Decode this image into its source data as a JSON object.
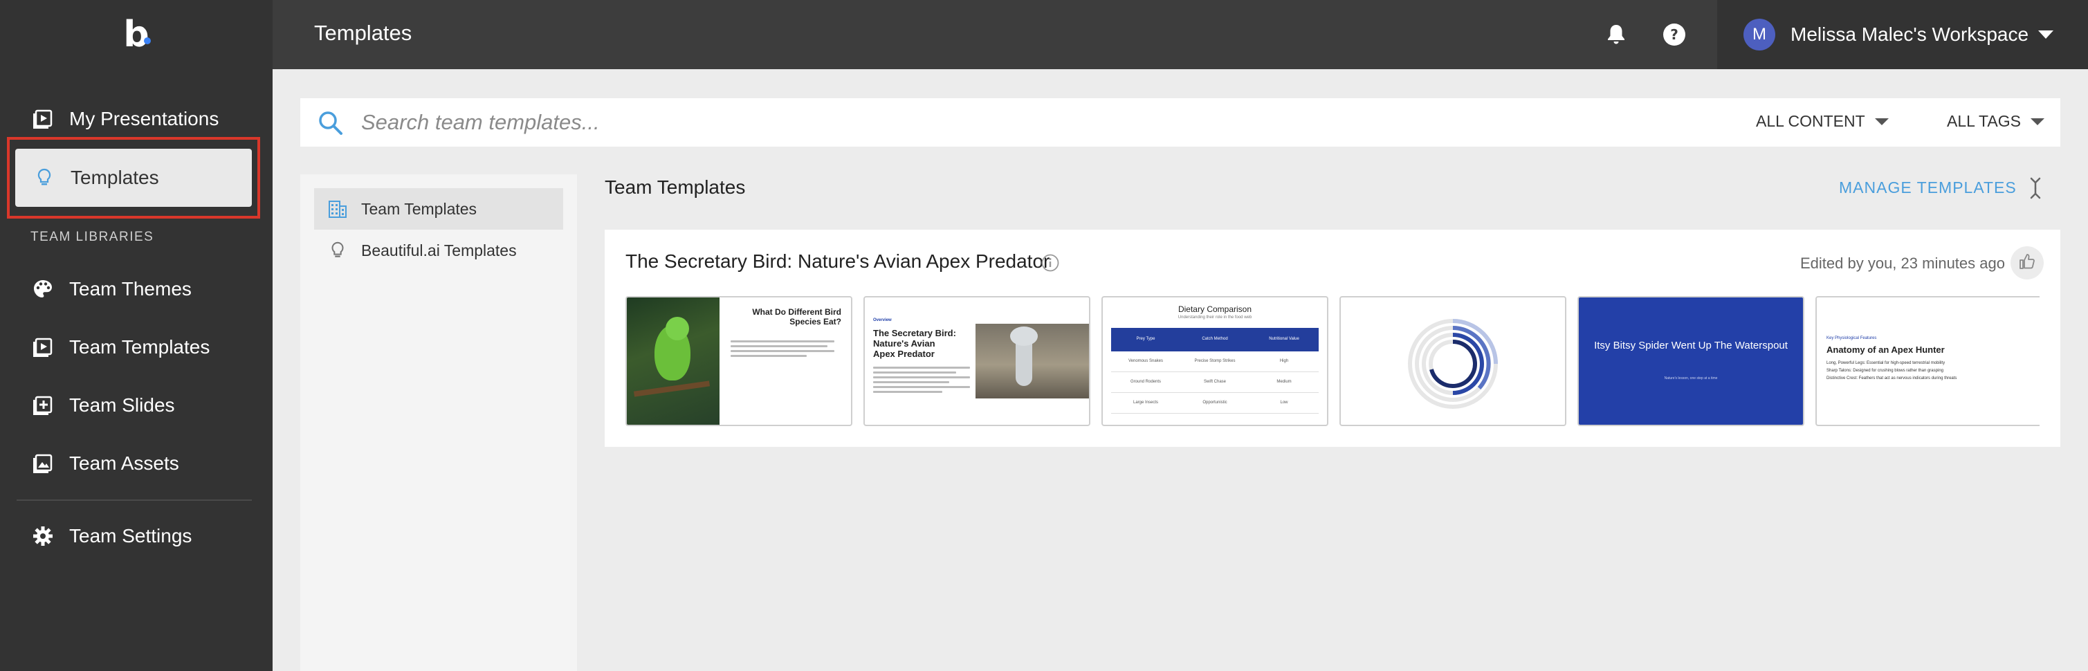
{
  "app": {
    "logo": "b",
    "accent_color": "#3b82f6",
    "highlight_color": "#d9372a"
  },
  "header": {
    "title": "Templates",
    "workspace": {
      "avatar_initial": "M",
      "name": "Melissa Malec's Workspace"
    }
  },
  "sidebar": {
    "items": [
      {
        "label": "My Presentations",
        "icon": "play-square-icon"
      },
      {
        "label": "Templates",
        "icon": "lightbulb-icon"
      }
    ],
    "section_label": "TEAM LIBRARIES",
    "team_items": [
      {
        "label": "Team Themes",
        "icon": "palette-icon"
      },
      {
        "label": "Team Templates",
        "icon": "play-square-icon"
      },
      {
        "label": "Team Slides",
        "icon": "add-slide-icon"
      },
      {
        "label": "Team Assets",
        "icon": "image-icon"
      }
    ],
    "settings": {
      "label": "Team Settings",
      "icon": "gear-icon"
    }
  },
  "search": {
    "placeholder": "Search team templates...",
    "filter_content": "ALL CONTENT",
    "filter_tags": "ALL TAGS"
  },
  "left_panel": {
    "items": [
      {
        "label": "Team Templates",
        "icon": "building-icon"
      },
      {
        "label": "Beautiful.ai Templates",
        "icon": "lightbulb-icon"
      }
    ]
  },
  "main": {
    "title": "Team Templates",
    "manage_label": "MANAGE TEMPLATES",
    "card": {
      "title": "The Secretary Bird: Nature's Avian Apex Predator",
      "edited": "Edited by you, 23 minutes ago",
      "slides": [
        {
          "title": "What Do Different Bird Species Eat?"
        },
        {
          "overline": "Overview",
          "title": "The Secretary Bird: Nature's Avian Apex Predator",
          "bullets": [
            "Introduction to Sagittarius serpentarius",
            "Unique predatory traits",
            "Beyond the African savanna"
          ]
        },
        {
          "title": "Dietary Comparison",
          "subtitle": "Understanding their role in the food web",
          "columns": [
            "Prey Type",
            "Catch Method",
            "Nutritional Value"
          ],
          "rows": [
            [
              "Venomous Snakes",
              "Precise Stomp Strikes",
              "High"
            ],
            [
              "Ground Rodents",
              "Swift Chase",
              "Medium"
            ],
            [
              "Large Insects",
              "Opportunistic",
              "Low"
            ]
          ]
        },
        {
          "type": "radial"
        },
        {
          "title": "Itsy Bitsy Spider Went Up The Waterspout",
          "subtitle": "Nature's lesson, one step at a time"
        },
        {
          "overline": "Key Physiological Features",
          "title": "Anatomy of an Apex Hunter",
          "bullets": [
            "Long, Powerful Legs: Essential for high-speed terrestrial mobility",
            "Sharp Talons: Designed for crushing blows rather than grasping",
            "Distinctive Crest: Feathers that act as nervous indicators during threats"
          ]
        }
      ]
    }
  }
}
